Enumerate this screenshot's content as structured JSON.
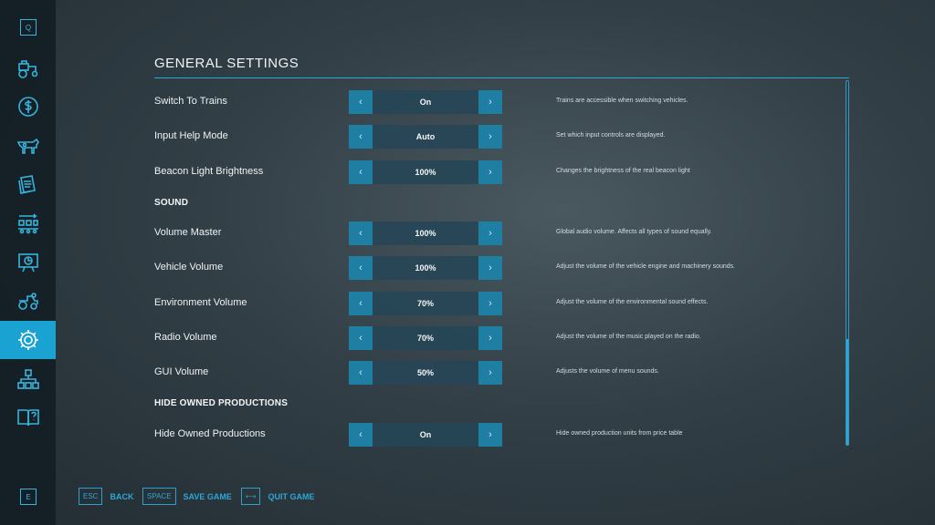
{
  "sidebar": {
    "top_key": "Q",
    "bottom_key": "E",
    "items": [
      {
        "icon": "tractor-icon"
      },
      {
        "icon": "dollar-icon"
      },
      {
        "icon": "cow-icon"
      },
      {
        "icon": "contracts-icon"
      },
      {
        "icon": "production-chain-icon"
      },
      {
        "icon": "presentation-icon"
      },
      {
        "icon": "vehicles-icon"
      },
      {
        "icon": "gear-icon",
        "active": true
      },
      {
        "icon": "hierarchy-icon"
      },
      {
        "icon": "help-book-icon"
      }
    ]
  },
  "header": {
    "title": "GENERAL SETTINGS"
  },
  "rows": [
    {
      "label": "Switch To Trains",
      "value": "On",
      "desc": "Trains are accessible when switching vehicles."
    },
    {
      "label": "Input Help Mode",
      "value": "Auto",
      "desc": "Set which input controls are displayed."
    },
    {
      "label": "Beacon Light Brightness",
      "value": "100%",
      "desc": "Changes the brightness of the real beacon light"
    },
    {
      "label": "Volume Master",
      "value": "100%",
      "desc": "Global audio volume. Affects all types of sound equally."
    },
    {
      "label": "Vehicle Volume",
      "value": "100%",
      "desc": "Adjust the volume of the vehicle engine and machinery sounds."
    },
    {
      "label": "Environment Volume",
      "value": "70%",
      "desc": "Adjust the volume of the environmental sound effects."
    },
    {
      "label": "Radio Volume",
      "value": "70%",
      "desc": "Adjust the volume of the music played on the radio."
    },
    {
      "label": "GUI Volume",
      "value": "50%",
      "desc": "Adjusts the volume of menu sounds."
    },
    {
      "label": "Hide Owned Productions",
      "value": "On",
      "desc": "Hide owned production units from price table"
    }
  ],
  "sections": {
    "sound": "SOUND",
    "hide_owned": "HIDE OWNED PRODUCTIONS"
  },
  "arrows": {
    "left": "‹",
    "right": "›"
  },
  "footer": {
    "back_key": "ESC",
    "back_label": "BACK",
    "save_key": "SPACE",
    "save_label": "SAVE GAME",
    "quit_key": "⟷",
    "quit_label": "QUIT GAME"
  },
  "colors": {
    "accent": "#1aa2d2",
    "arrow_bg": "#1f7fa3",
    "value_bg": "#264656"
  }
}
